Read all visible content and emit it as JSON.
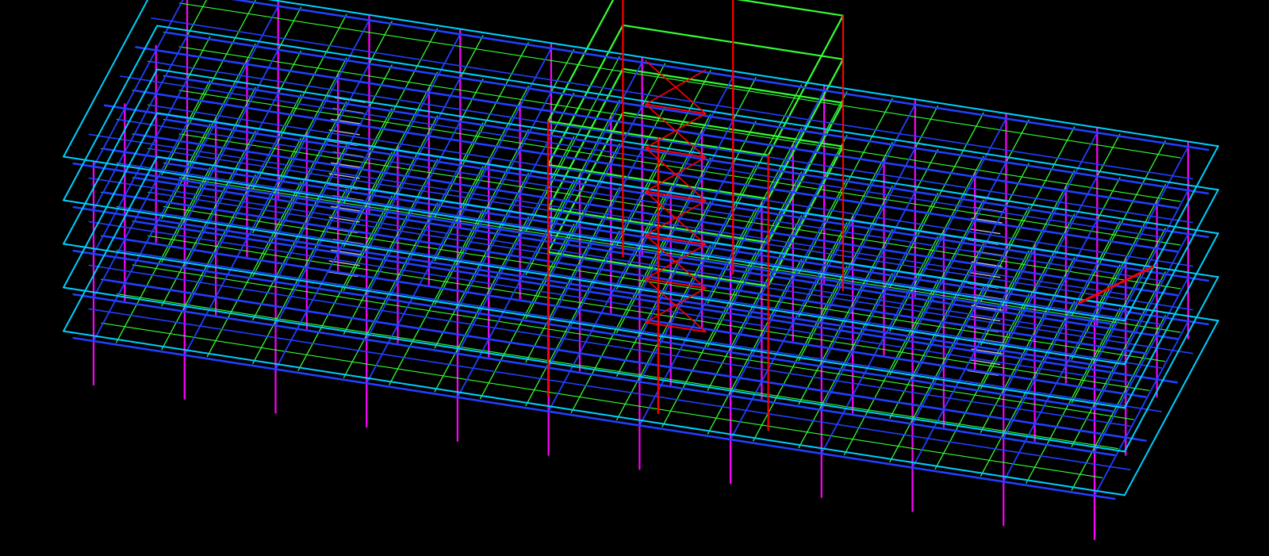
{
  "scene": {
    "background": "#000000",
    "view": "isometric-wireframe",
    "layer_colors": {
      "columns": "#ff00ff",
      "primary_beams": "#2040ff",
      "secondary_beams": "#33ff33",
      "edge_members": "#00d0ff",
      "core_framing": "#ff0000",
      "stairs_equipment": "#c0c0c0"
    },
    "structure": {
      "main_levels": 5,
      "core_levels": 6,
      "bays_along_length": 11,
      "bays_across_width": 6
    }
  }
}
